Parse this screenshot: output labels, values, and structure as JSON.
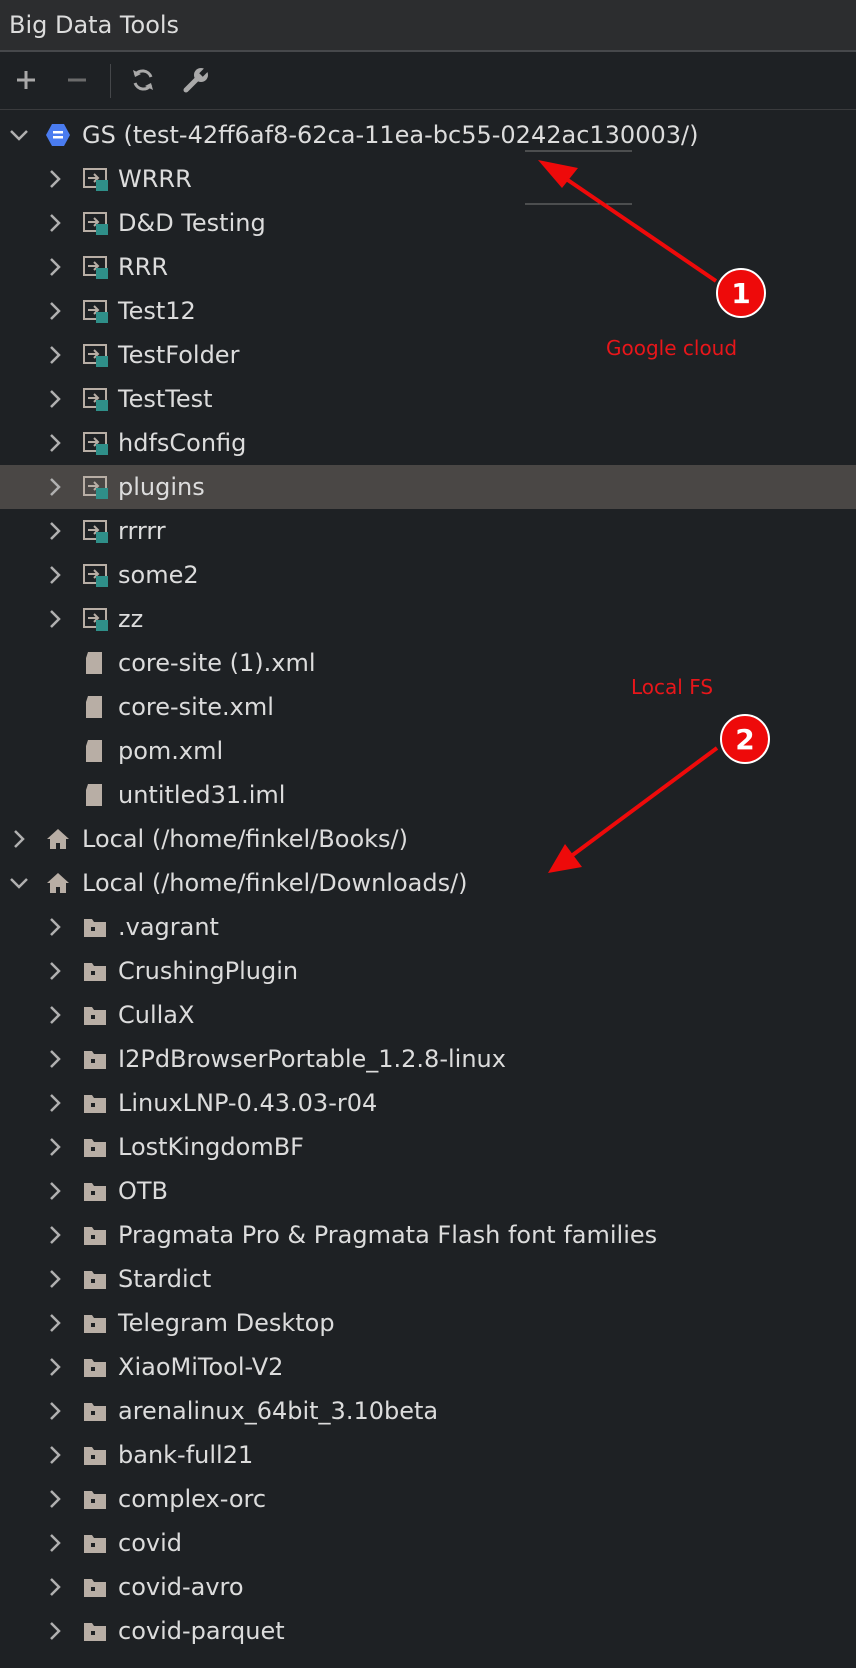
{
  "window": {
    "title": "Big Data Tools"
  },
  "toolbar": {
    "add_icon": "plus-icon",
    "remove_icon": "minus-icon",
    "refresh_icon": "refresh-icon",
    "settings_icon": "wrench-icon"
  },
  "tree": {
    "gs_root": {
      "label": "GS (test-42ff6af8-62ca-11ea-bc55-0242ac130003/)",
      "icon": "google-storage-icon"
    },
    "gs_items": [
      {
        "label": " WRRR"
      },
      {
        "label": "D&D Testing"
      },
      {
        "label": "RRR"
      },
      {
        "label": "Test12"
      },
      {
        "label": "TestFolder"
      },
      {
        "label": "TestTest"
      },
      {
        "label": "hdfsConfig"
      },
      {
        "label": "plugins"
      },
      {
        "label": "rrrrr"
      },
      {
        "label": "some2"
      },
      {
        "label": "zz"
      }
    ],
    "gs_files": [
      {
        "label": "core-site (1).xml"
      },
      {
        "label": "core-site.xml"
      },
      {
        "label": "pom.xml"
      },
      {
        "label": "untitled31.iml"
      }
    ],
    "local_books": {
      "label": "Local (/home/finkel/Books/)",
      "icon": "home-icon"
    },
    "local_downloads": {
      "label": "Local (/home/finkel/Downloads/)",
      "icon": "home-icon"
    },
    "local_items": [
      {
        "label": ".vagrant"
      },
      {
        "label": "CrushingPlugin"
      },
      {
        "label": "CullaX"
      },
      {
        "label": "I2PdBrowserPortable_1.2.8-linux"
      },
      {
        "label": "LinuxLNP-0.43.03-r04"
      },
      {
        "label": "LostKingdomBF"
      },
      {
        "label": "OTB"
      },
      {
        "label": "Pragmata Pro & Pragmata Flash font families"
      },
      {
        "label": "Stardict"
      },
      {
        "label": "Telegram Desktop"
      },
      {
        "label": "XiaoMiTool-V2"
      },
      {
        "label": "arenalinux_64bit_3.10beta"
      },
      {
        "label": "bank-full21"
      },
      {
        "label": "complex-orc"
      },
      {
        "label": "covid"
      },
      {
        "label": "covid-avro"
      },
      {
        "label": "covid-parquet"
      }
    ]
  },
  "annotations": [
    {
      "number": "1",
      "text": "Google cloud"
    },
    {
      "number": "2",
      "text": "Local FS"
    }
  ],
  "colors": {
    "background": "#1e2124",
    "selection": "#4a4745",
    "annotation_red": "#ee0a0a",
    "gs_blue": "#4a7cf0",
    "folder_icon": "#b8aea5",
    "teal_accent": "#2f8f89"
  }
}
